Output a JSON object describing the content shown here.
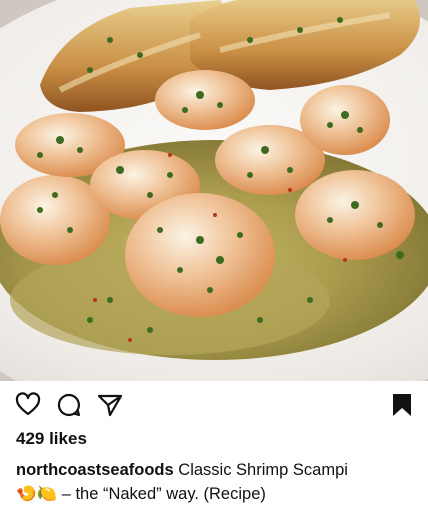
{
  "post": {
    "image_description": "",
    "likes": "429 likes",
    "username": "northcoastseafoods",
    "caption_line1": "Classic Shrimp Scampi",
    "caption_emojis": "🍤🍋",
    "caption_line2": "– the “Naked” way. (Recipe)"
  },
  "actions": {
    "like_icon": "heart-outline",
    "comment_icon": "speech-bubble",
    "share_icon": "paper-plane",
    "save_icon": "bookmark-filled"
  },
  "colors": {
    "text": "#111111",
    "icon": "#111111",
    "background": "#ffffff"
  }
}
